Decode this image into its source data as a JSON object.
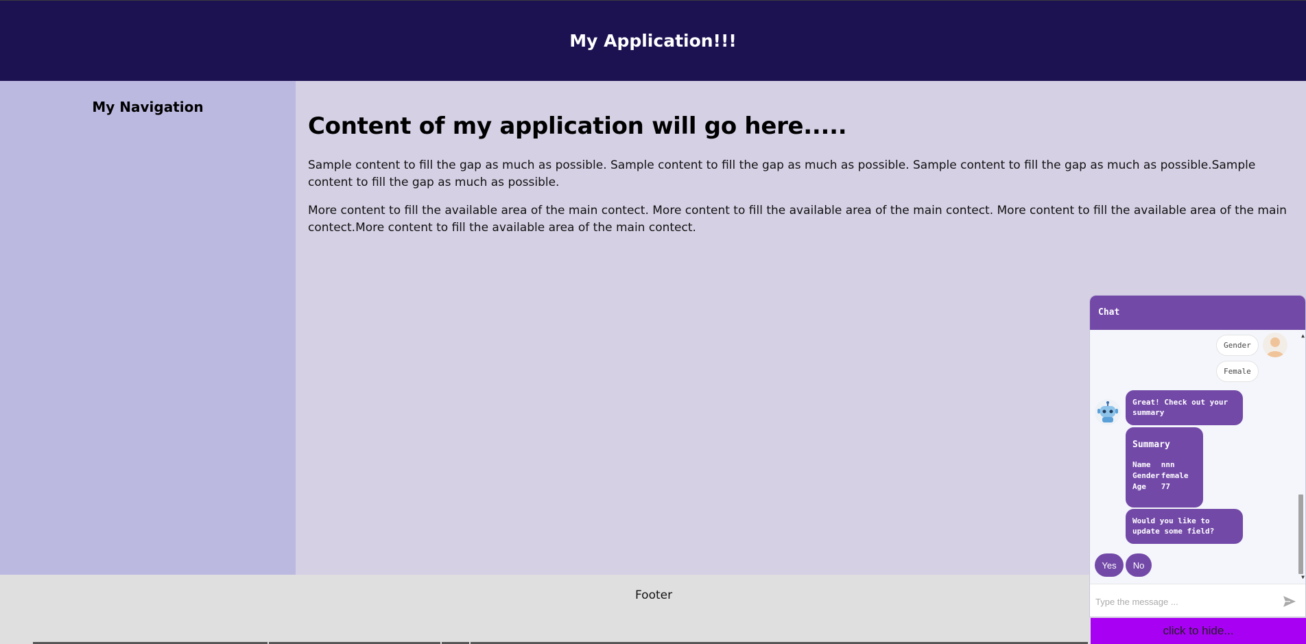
{
  "header": {
    "title": "My Application!!!"
  },
  "nav": {
    "title": "My Navigation"
  },
  "main": {
    "heading": "Content of my application will go here.....",
    "paragraphs": [
      "Sample content to fill the gap as much as possible. Sample content to fill the gap as much as possible. Sample content to fill the gap as much as possible.Sample content to fill the gap as much as possible.",
      "More content to fill the available area of the main contect. More content to fill the available area of the main contect. More content to fill the available area of the main contect.More content to fill the available area of the main contect."
    ]
  },
  "footer": {
    "label": "Footer"
  },
  "chat": {
    "title": "Chat",
    "user_messages": [
      "Gender",
      "Female"
    ],
    "bot_messages": [
      "Great! Check out your summary",
      "Would you like to update some field?"
    ],
    "summary": {
      "title": "Summary",
      "rows": [
        {
          "label": "Name",
          "value": "nnn"
        },
        {
          "label": "Gender",
          "value": "female"
        },
        {
          "label": "Age",
          "value": "77"
        }
      ]
    },
    "quick_replies": [
      "Yes",
      "No"
    ],
    "input_placeholder": "Type the message ...",
    "hide_label": "click to hide..."
  },
  "colors": {
    "header_bg": "#1c1252",
    "nav_bg": "#bcb9e1",
    "main_bg": "#d5d0e4",
    "footer_bg": "#dfdfdf",
    "chat_accent": "#7349a8",
    "hide_bar": "#a700f2"
  },
  "icons": [
    "user-avatar-icon",
    "robot-icon",
    "send-icon",
    "scroll-up-arrow-icon",
    "scroll-down-arrow-icon"
  ]
}
